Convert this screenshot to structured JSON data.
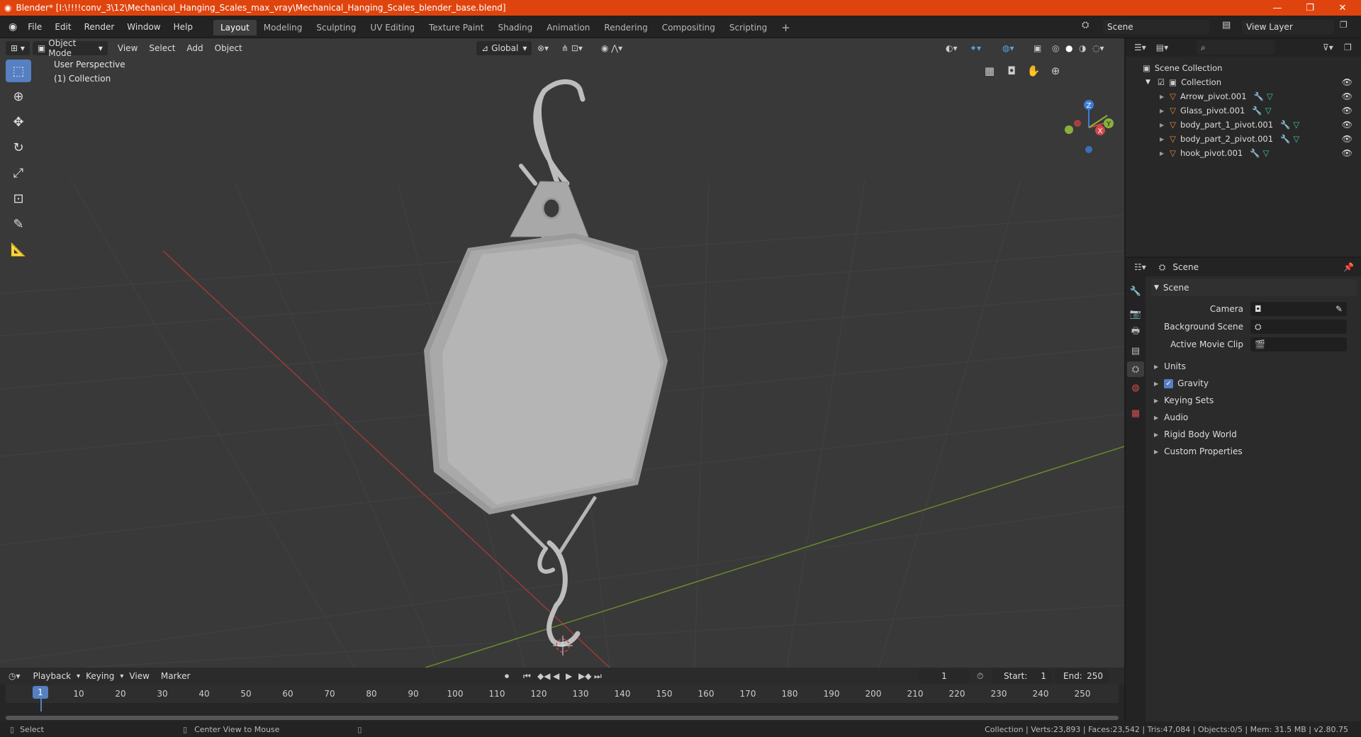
{
  "window": {
    "title": "Blender* [I:\\!!!!conv_3\\12\\Mechanical_Hanging_Scales_max_vray\\Mechanical_Hanging_Scales_blender_base.blend]",
    "controls": [
      "—",
      "❐",
      "✕"
    ]
  },
  "menu": [
    "File",
    "Edit",
    "Render",
    "Window",
    "Help"
  ],
  "workspaces": [
    "Layout",
    "Modeling",
    "Sculpting",
    "UV Editing",
    "Texture Paint",
    "Shading",
    "Animation",
    "Rendering",
    "Compositing",
    "Scripting"
  ],
  "add_workspace": "+",
  "scene_field": "Scene",
  "view_layer_field": "View Layer",
  "viewport": {
    "mode": "Object Mode",
    "menus": [
      "View",
      "Select",
      "Add",
      "Object"
    ],
    "orientation": "Global",
    "perspective_label": "User Perspective",
    "collection_label": "(1) Collection",
    "axes": {
      "x": "X",
      "y": "Y",
      "z": "Z"
    }
  },
  "outliner": {
    "root": "Scene Collection",
    "collection": "Collection",
    "items": [
      "Arrow_pivot.001",
      "Glass_pivot.001",
      "body_part_1_pivot.001",
      "body_part_2_pivot.001",
      "hook_pivot.001"
    ]
  },
  "properties": {
    "header": "Scene",
    "section": "Scene",
    "fields": [
      {
        "label": "Camera",
        "value": ""
      },
      {
        "label": "Background Scene",
        "value": ""
      },
      {
        "label": "Active Movie Clip",
        "value": ""
      }
    ],
    "panels": [
      "Units",
      "Gravity",
      "Keying Sets",
      "Audio",
      "Rigid Body World",
      "Custom Properties"
    ]
  },
  "timeline": {
    "menus": [
      "Playback",
      "Keying",
      "View",
      "Marker"
    ],
    "current_frame": "1",
    "start_label": "Start:",
    "start": "1",
    "end_label": "End:",
    "end": "250",
    "ticks": [
      "10",
      "20",
      "30",
      "40",
      "50",
      "60",
      "70",
      "80",
      "90",
      "100",
      "110",
      "120",
      "130",
      "140",
      "150",
      "160",
      "170",
      "180",
      "190",
      "200",
      "210",
      "220",
      "230",
      "240",
      "250"
    ],
    "playhead": "1"
  },
  "status": {
    "left": "Select",
    "middle": "Center View to Mouse",
    "right": "Collection | Verts:23,893 | Faces:23,542 | Tris:47,084 | Objects:0/5 | Mem: 31.5 MB | v2.80.75"
  },
  "colors": {
    "accent": "#5680c2",
    "title_bar": "#e0440e",
    "object_icon": "#e88a3a"
  }
}
